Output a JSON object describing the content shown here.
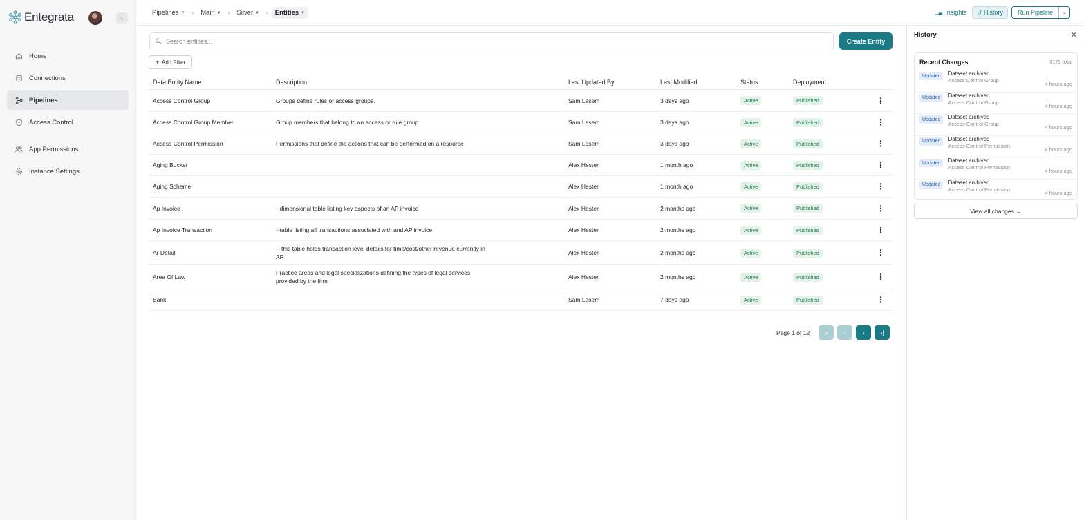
{
  "app": {
    "name": "Entegrata"
  },
  "colors": {
    "accent": "#1a7b86",
    "active_badge": "#1f7a45",
    "updated_badge": "#2f5fa6"
  },
  "sidebar": {
    "items": [
      {
        "label": "Home",
        "icon": "home-icon"
      },
      {
        "label": "Connections",
        "icon": "database-icon"
      },
      {
        "label": "Pipelines",
        "icon": "pipeline-icon",
        "active": true
      },
      {
        "label": "Access Control",
        "icon": "shield-icon"
      },
      {
        "label": "App Permissions",
        "icon": "users-icon"
      },
      {
        "label": "Instance Settings",
        "icon": "gear-icon"
      }
    ]
  },
  "breadcrumb": [
    {
      "label": "Pipelines"
    },
    {
      "label": "Main"
    },
    {
      "label": "Silver"
    },
    {
      "label": "Entities"
    }
  ],
  "toolbar": {
    "insights": "Insights",
    "history": "History",
    "run_pipeline": "Run Pipeline"
  },
  "main": {
    "search_placeholder": "Search entities...",
    "create_entity": "Create Entity",
    "add_filter": "Add Filter",
    "columns": [
      "Data Entity Name",
      "Description",
      "Last Updated By",
      "Last Modified",
      "Status",
      "Deployment"
    ],
    "rows": [
      {
        "name": "Access Control Group",
        "description": "Groups define rules or access groups.",
        "updated_by": "Sam Lesem",
        "modified": "3 days ago",
        "status": "Active",
        "deployment": "Published"
      },
      {
        "name": "Access Control Group Member",
        "description": "Group members that belong to an access or rule group",
        "updated_by": "Sam Lesem",
        "modified": "3 days ago",
        "status": "Active",
        "deployment": "Published"
      },
      {
        "name": "Access Control Permission",
        "description": "Permissions that define the actions that can be performed on a resource",
        "updated_by": "Sam Lesem",
        "modified": "3 days ago",
        "status": "Active",
        "deployment": "Published"
      },
      {
        "name": "Aging Bucket",
        "description": "",
        "updated_by": "Alex Hester",
        "modified": "1 month ago",
        "status": "Active",
        "deployment": "Published"
      },
      {
        "name": "Aging Scheme",
        "description": "",
        "updated_by": "Alex Hester",
        "modified": "1 month ago",
        "status": "Active",
        "deployment": "Published"
      },
      {
        "name": "Ap Invoice",
        "description": "--dimensional table listing key aspects of an AP invoice",
        "updated_by": "Alex Hester",
        "modified": "2 months ago",
        "status": "Active",
        "deployment": "Published"
      },
      {
        "name": "Ap Invoice Transaction",
        "description": "--table listing all transactions associated with and AP invoice",
        "updated_by": "Alex Hester",
        "modified": "2 months ago",
        "status": "Active",
        "deployment": "Published"
      },
      {
        "name": "Ar Detail",
        "description": "-- this table holds transaction level details for time/cost/other revenue currently in AR",
        "updated_by": "Alex Hester",
        "modified": "2 months ago",
        "status": "Active",
        "deployment": "Published"
      },
      {
        "name": "Area Of Law",
        "description": "Practice areas and legal specializations defining the types of legal services provided by the firm",
        "updated_by": "Alex Hester",
        "modified": "2 months ago",
        "status": "Active",
        "deployment": "Published"
      },
      {
        "name": "Bank",
        "description": "",
        "updated_by": "Sam Lesem",
        "modified": "7 days ago",
        "status": "Active",
        "deployment": "Published"
      }
    ],
    "pagination": {
      "text": "Page 1 of 12"
    }
  },
  "history": {
    "title": "History",
    "recent_title": "Recent Changes",
    "total": "9173 total",
    "items": [
      {
        "badge": "Updated",
        "action": "Dataset archived",
        "target": "Access Control Group",
        "time": "4 hours ago"
      },
      {
        "badge": "Updated",
        "action": "Dataset archived",
        "target": "Access Control Group",
        "time": "4 hours ago"
      },
      {
        "badge": "Updated",
        "action": "Dataset archived",
        "target": "Access Control Group",
        "time": "4 hours ago"
      },
      {
        "badge": "Updated",
        "action": "Dataset archived",
        "target": "Access Control Permission",
        "time": "4 hours ago"
      },
      {
        "badge": "Updated",
        "action": "Dataset archived",
        "target": "Access Control Permission",
        "time": "4 hours ago"
      },
      {
        "badge": "Updated",
        "action": "Dataset archived",
        "target": "Access Control Permission",
        "time": "4 hours ago"
      }
    ],
    "view_all": "View all changes →"
  }
}
